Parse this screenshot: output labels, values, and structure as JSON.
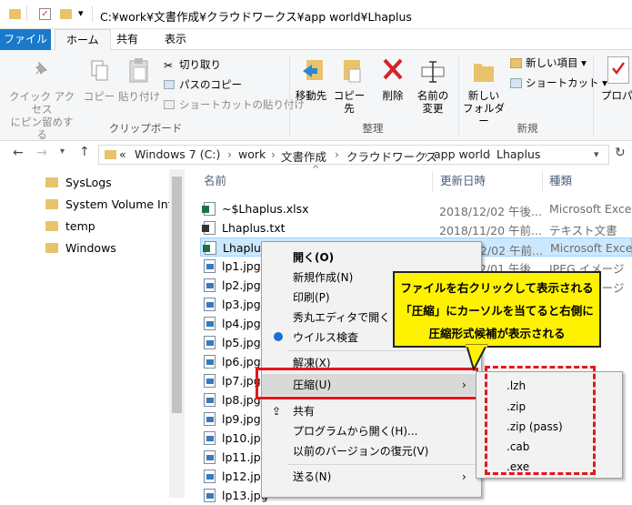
{
  "window": {
    "title": "C:¥work¥文書作成¥クラウドワークス¥app world¥Lhaplus"
  },
  "tabs": {
    "file": "ファイル",
    "home": "ホーム",
    "share": "共有",
    "view": "表示"
  },
  "ribbon": {
    "pin": "クイック アクセス\nにピン留めする",
    "copy": "コピー",
    "paste": "貼り付け",
    "cut": "切り取り",
    "copy_path": "パスのコピー",
    "paste_shortcut": "ショートカットの貼り付け",
    "clipboard_label": "クリップボード",
    "move_to": "移動先",
    "copy_to": "コピー先",
    "delete": "削除",
    "rename": "名前の\n変更",
    "organize_label": "整理",
    "new_folder": "新しい\nフォルダー",
    "new_item": "新しい項目",
    "shortcut": "ショートカット",
    "new_label": "新規",
    "properties": "プロパティ"
  },
  "address": {
    "chevron": "«",
    "crumbs": [
      "Windows 7 (C:)",
      "work",
      "文書作成",
      "クラウドワークス",
      "app world",
      "Lhaplus"
    ]
  },
  "nav": {
    "items": [
      "SysLogs",
      "System Volume Info",
      "temp",
      "Windows"
    ]
  },
  "columns": {
    "name": "名前",
    "date": "更新日時",
    "type": "種類"
  },
  "files": [
    {
      "name": "~$Lhaplus.xlsx",
      "date": "2018/12/02 午後...",
      "type": "Microsoft Excel",
      "icon": "excel"
    },
    {
      "name": "Lhaplus.txt",
      "date": "2018/11/20 午前...",
      "type": "テキスト文書",
      "icon": "text"
    },
    {
      "name": "Lhaplus.xlsx",
      "date": "2018/12/02 午前...",
      "type": "Microsoft Excel",
      "icon": "excel"
    },
    {
      "name": "lp1.jpg",
      "date": "2018/12/01 午後...",
      "type": "JPEG イメージ",
      "icon": "jpg"
    },
    {
      "name": "lp2.jpg",
      "date": "2018/12/01 午後...",
      "type": "JPEG イメージ",
      "icon": "jpg"
    },
    {
      "name": "lp3.jpg",
      "date": "",
      "type": "",
      "icon": "jpg"
    },
    {
      "name": "lp4.jpg",
      "date": "",
      "type": "",
      "icon": "jpg"
    },
    {
      "name": "lp5.jpg",
      "date": "",
      "type": "",
      "icon": "jpg"
    },
    {
      "name": "lp6.jpg",
      "date": "",
      "type": "",
      "icon": "jpg"
    },
    {
      "name": "lp7.jpg",
      "date": "",
      "type": "",
      "icon": "jpg"
    },
    {
      "name": "lp8.jpg",
      "date": "",
      "type": "",
      "icon": "jpg"
    },
    {
      "name": "lp9.jpg",
      "date": "",
      "type": "",
      "icon": "jpg"
    },
    {
      "name": "lp10.jpg",
      "date": "",
      "type": "",
      "icon": "jpg"
    },
    {
      "name": "lp11.jpg",
      "date": "",
      "type": "",
      "icon": "jpg"
    },
    {
      "name": "lp12.jpg",
      "date": "",
      "type": "",
      "icon": "jpg"
    },
    {
      "name": "lp13.jpg",
      "date": "",
      "type": "",
      "icon": "jpg"
    }
  ],
  "context_menu": {
    "open": "開く(O)",
    "new": "新規作成(N)",
    "print": "印刷(P)",
    "hidemaru": "秀丸エディタで開く",
    "virus": "ウイルス検査",
    "extract": "解凍(X)",
    "compress": "圧縮(U)",
    "share": "共有",
    "open_with": "プログラムから開く(H)...",
    "restore": "以前のバージョンの復元(V)",
    "send_to": "送る(N)"
  },
  "submenu": {
    "items": [
      ".lzh",
      ".zip",
      ".zip (pass)",
      ".cab",
      ".exe"
    ]
  },
  "callout": {
    "line1": "ファイルを右クリックして表示される",
    "line2": "「圧縮」にカーソルを当てると右側に",
    "line3": "圧縮形式候補が表示される"
  },
  "colors": {
    "accent": "#1979ca",
    "highlight": "#e5161d",
    "callout": "#fff200"
  }
}
